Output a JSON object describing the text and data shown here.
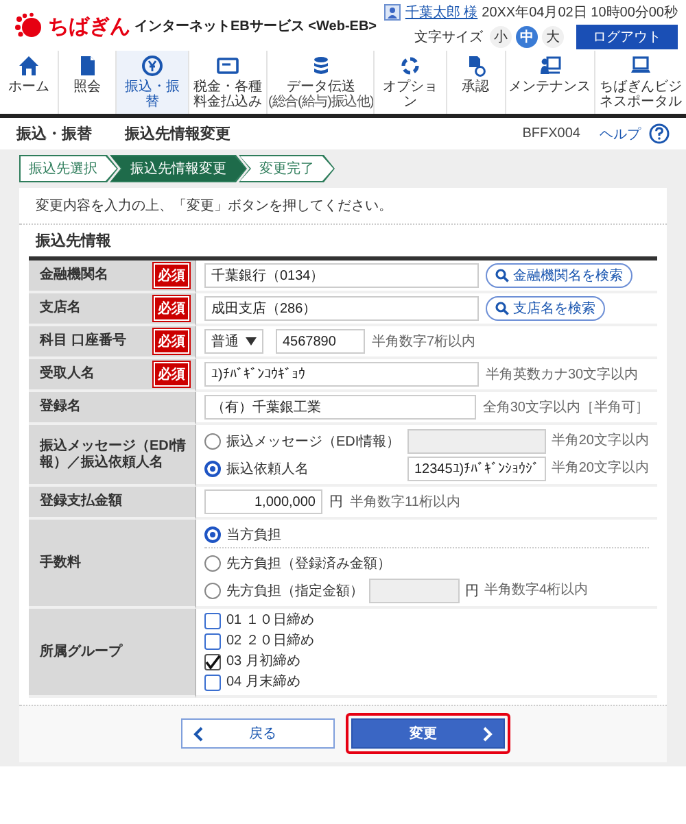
{
  "header": {
    "logo": "ちばぎん",
    "service": "インターネットEBサービス <Web-EB>",
    "user": "千葉太郎 様",
    "datetime": "20XX年04月02日 10時00分00秒",
    "font_size_label": "文字サイズ",
    "font_sizes": [
      {
        "label": "小",
        "selected": false
      },
      {
        "label": "中",
        "selected": true
      },
      {
        "label": "大",
        "selected": false
      }
    ],
    "logout": "ログアウト"
  },
  "nav": [
    {
      "kind": "home",
      "label": "ホーム",
      "selected": false
    },
    {
      "kind": "document",
      "label": "照会",
      "selected": false
    },
    {
      "kind": "transfer",
      "label": "振込・振替",
      "selected": true
    },
    {
      "kind": "bill",
      "label": "税金・各種料金払込み",
      "selected": false
    },
    {
      "kind": "data",
      "label": "データ伝送",
      "sub": "(総合(給与)振込他)",
      "selected": false
    },
    {
      "kind": "option",
      "label": "オプション",
      "selected": false
    },
    {
      "kind": "approval",
      "label": "承認",
      "selected": false
    },
    {
      "kind": "maintenance",
      "label": "メンテナンス",
      "selected": false
    },
    {
      "kind": "portal",
      "label": "ちばぎんビジネスポータル",
      "selected": false
    }
  ],
  "page": {
    "title": "振込・振替",
    "subtitle": "振込先情報変更",
    "screen_id": "BFFX004",
    "help": "ヘルプ"
  },
  "steps": [
    {
      "label": "振込先選択",
      "selected": false
    },
    {
      "label": "振込先情報変更",
      "selected": true
    },
    {
      "label": "変更完了",
      "selected": false
    }
  ],
  "intro": "変更内容を入力の上、「変更」ボタンを押してください。",
  "section_title": "振込先情報",
  "rows": [
    {
      "kind": "search",
      "label": "金融機関名",
      "badge": "必須",
      "value": "千葉銀行（0134）",
      "button": "金融機関名を検索"
    },
    {
      "kind": "search",
      "label": "支店名",
      "badge": "必須",
      "value": "成田支店（286）",
      "button": "支店名を検索"
    },
    {
      "kind": "account",
      "label": "科目 口座番号",
      "badge": "必須",
      "select": "普通",
      "value": "4567890",
      "hint": "半角数字7桁以内"
    },
    {
      "kind": "text",
      "label": "受取人名",
      "badge": "必須",
      "value": "ﾕ)ﾁﾊﾞｷﾞﾝｺｳｷﾞｮｳ",
      "hint": "半角英数カナ30文字以内"
    },
    {
      "kind": "text",
      "label": "登録名",
      "value": "（有）千葉銀工業",
      "hint": "全角30文字以内［半角可］"
    },
    {
      "kind": "message",
      "label": "振込メッセージ（EDI情報）／振込依頼人名",
      "options": [
        {
          "label": "振込メッセージ（EDI情報）",
          "selected": false,
          "field": {
            "disabled": true
          },
          "hint": "半角20文字以内"
        },
        {
          "label": "振込依頼人名",
          "selected": true,
          "field": {
            "value": "12345ﾕ)ﾁﾊﾞｷﾞﾝｼｮｳｼﾞ"
          },
          "hint": "半角20文字以内"
        }
      ]
    },
    {
      "kind": "amount",
      "label": "登録支払金額",
      "value": "1,000,000",
      "unit": "円",
      "hint": "半角数字11桁以内"
    },
    {
      "kind": "fee",
      "label": "手数料",
      "options": [
        {
          "label": "当方負担",
          "selected": true,
          "divider_after": true
        },
        {
          "label": "先方負担（登録済み金額）",
          "selected": false
        },
        {
          "label": "先方負担（指定金額）",
          "selected": false,
          "field": {
            "disabled": true
          },
          "unit": "円",
          "hint": "半角数字4桁以内"
        }
      ]
    },
    {
      "kind": "checks",
      "label": "所属グループ",
      "options": [
        {
          "label": "01 １０日締め",
          "checked": false
        },
        {
          "label": "02 ２０日締め",
          "checked": false
        },
        {
          "label": "03 月初締め",
          "checked": true
        },
        {
          "label": "04 月末締め",
          "checked": false
        }
      ]
    }
  ],
  "buttons": [
    {
      "kind": "back",
      "label": "戻る"
    },
    {
      "kind": "submit",
      "label": "変更",
      "highlighted": true
    }
  ]
}
